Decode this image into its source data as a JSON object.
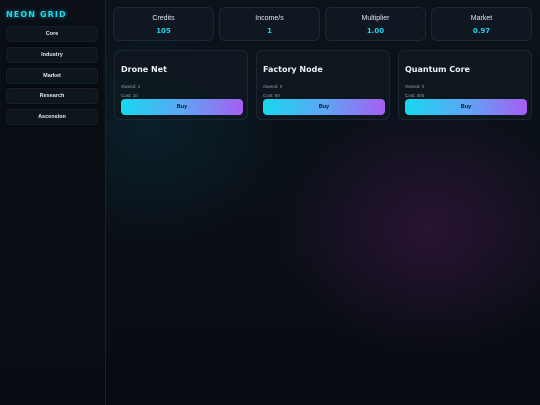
{
  "app": {
    "title": "NEON GRID"
  },
  "nav": {
    "items": [
      {
        "label": "Core"
      },
      {
        "label": "Industry"
      },
      {
        "label": "Market"
      },
      {
        "label": "Research"
      },
      {
        "label": "Ascension"
      }
    ]
  },
  "stats": [
    {
      "label": "Credits",
      "value": "105"
    },
    {
      "label": "Income/s",
      "value": "1"
    },
    {
      "label": "Multiplier",
      "value": "1.00"
    },
    {
      "label": "Market",
      "value": "0.97"
    }
  ],
  "buildings": [
    {
      "name": "Drone Net",
      "owned": "Owned: 1",
      "cost": "Cost: 10",
      "buy_label": "Buy"
    },
    {
      "name": "Factory Node",
      "owned": "Owned: 0",
      "cost": "Cost: 60",
      "buy_label": "Buy"
    },
    {
      "name": "Quantum Core",
      "owned": "Owned: 0",
      "cost": "Cost: 400",
      "buy_label": "Buy"
    }
  ],
  "colors": {
    "accent": "#1fd8ee",
    "buy_gradient_start": "#16d8f0",
    "buy_gradient_end": "#a55ef2",
    "background": "#0a0f16"
  }
}
